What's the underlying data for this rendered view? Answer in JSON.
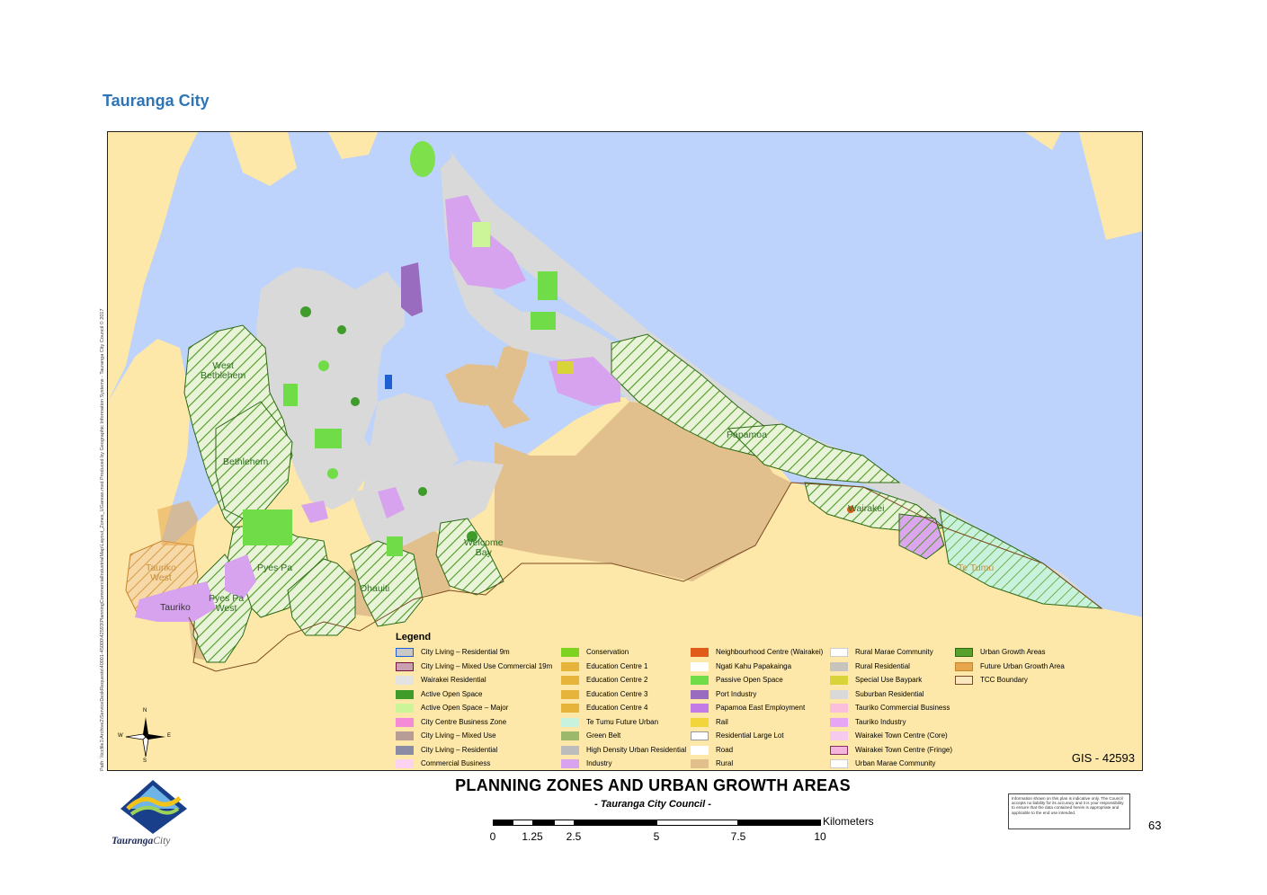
{
  "heading": "Tauranga City",
  "map": {
    "side_text": "Path: \\\\tccfile1\\Archive2\\ServiceDeskRequests\\40001-45000\\42593\\PlanningCommercialIndustrialMap\\Layout_Zones_UGareas.mxd     Produced by Geographic Information Systems - Tauranga City Council © 2017",
    "places": {
      "west_bethlehem": "West\nBethlehem",
      "bethlehem": "Bethlehem",
      "papamoa": "Papamoa",
      "wairakei": "Wairakei",
      "te_tumu": "Te Tumu",
      "welcome_bay": "Welcome\nBay",
      "pyes_pa": "Pyes Pa",
      "ohauiti": "Ohauiti",
      "pyes_pa_west": "Pyes Pa\nWest",
      "tauriko": "Tauriko",
      "tauriko_west": "Tauriko\nWest"
    },
    "colors": {
      "sea": "#bdd3fb",
      "rural": "#fde8a9",
      "suburban": "#d9d9d9",
      "urban_growth": "#5aa02c",
      "future_growth": "#e6a64d",
      "industry": "#d7a3ee",
      "rural_zone": "#e2c08d",
      "open_space": "#7ee04a",
      "te_tumu": "#c6f2de"
    },
    "gis_ref": "GIS - 42593"
  },
  "legend": {
    "title": "Legend",
    "items": [
      {
        "label": "City Living – Residential 9m",
        "fill": "#c8c8c8",
        "border": "#1f5fd1"
      },
      {
        "label": "City Living – Mixed Use Commercial 19m",
        "fill": "#c8a0b0",
        "border": "#7a1040"
      },
      {
        "label": "Wairakei Residential",
        "fill": "#e3e3e3",
        "border": "#e3e3e3"
      },
      {
        "label": "Active Open Space",
        "fill": "#3f9b2a",
        "border": "#3f9b2a"
      },
      {
        "label": "Active Open Space – Major",
        "fill": "#ccf59a",
        "border": "#ccf59a"
      },
      {
        "label": "City Centre Business Zone",
        "fill": "#f58ad7",
        "border": "#f58ad7"
      },
      {
        "label": "City Living – Mixed Use",
        "fill": "#b89c96",
        "border": "#b89c96"
      },
      {
        "label": "City Living – Residential",
        "fill": "#8a8ca6",
        "border": "#8a8ca6"
      },
      {
        "label": "Commercial Business",
        "fill": "#fbd3f0",
        "border": "#fbd3f0"
      },
      {
        "label": "Conservation",
        "fill": "#7ed321",
        "border": "#7ed321"
      },
      {
        "label": "Education Centre 1",
        "fill": "#e6b43b",
        "border": "#e6b43b"
      },
      {
        "label": "Education Centre 2",
        "fill": "#e6b43b",
        "border": "#e6b43b"
      },
      {
        "label": "Education Centre 3",
        "fill": "#e6b43b",
        "border": "#e6b43b"
      },
      {
        "label": "Education Centre 4",
        "fill": "#e6b43b",
        "border": "#e6b43b"
      },
      {
        "label": "Te Tumu Future Urban",
        "fill": "#c6f2de",
        "border": "#c6f2de"
      },
      {
        "label": "Green Belt",
        "fill": "#9cb86a",
        "border": "#9cb86a"
      },
      {
        "label": "High Density Urban Residential",
        "fill": "#bcbcbc",
        "border": "#bcbcbc"
      },
      {
        "label": "Industry",
        "fill": "#d7a3ee",
        "border": "#d7a3ee"
      },
      {
        "label": "Neighbourhood Centre (Wairakei)",
        "fill": "#e05a1a",
        "border": "#e05a1a"
      },
      {
        "label": "Ngati Kahu Papakainga",
        "fill": "#ffffff",
        "border": "#ffffff"
      },
      {
        "label": "Passive Open Space",
        "fill": "#6fdc48",
        "border": "#6fdc48"
      },
      {
        "label": "Port Industry",
        "fill": "#9a6cc0",
        "border": "#9a6cc0"
      },
      {
        "label": "Papamoa East Employment",
        "fill": "#c37ae6",
        "border": "#c37ae6"
      },
      {
        "label": "Rail",
        "fill": "#f2d53a",
        "border": "#f2d53a"
      },
      {
        "label": "Residential Large Lot",
        "fill": "#ffffff",
        "border": "#999999"
      },
      {
        "label": "Road",
        "fill": "#ffffff",
        "border": "#ffffff"
      },
      {
        "label": "Rural",
        "fill": "#e2c08d",
        "border": "#e2c08d"
      },
      {
        "label": "Rural Marae Community",
        "fill": "#ffffff",
        "border": "#cccccc"
      },
      {
        "label": "Rural Residential",
        "fill": "#c7c4bd",
        "border": "#c7c4bd"
      },
      {
        "label": "Special Use Baypark",
        "fill": "#d9d33a",
        "border": "#d9d33a"
      },
      {
        "label": "Suburban Residential",
        "fill": "#d9d9d9",
        "border": "#d9d9d9"
      },
      {
        "label": "Tauriko Commercial Business",
        "fill": "#fbbfdc",
        "border": "#fbbfdc"
      },
      {
        "label": "Tauriko Industry",
        "fill": "#e6a6f5",
        "border": "#e6a6f5"
      },
      {
        "label": "Wairakei Town Centre (Core)",
        "fill": "#f6c9ef",
        "border": "#f6c9ef"
      },
      {
        "label": "Wairakei Town Centre (Fringe)",
        "fill": "#f3b5dc",
        "border": "#8a3060"
      },
      {
        "label": "Urban Marae Community",
        "fill": "#ffffff",
        "border": "#cccccc"
      },
      {
        "label": "Urban Growth Areas",
        "fill": "#5aa02c",
        "border": "#2c6a14"
      },
      {
        "label": "Future Urban Growth Area",
        "fill": "#e6a64d",
        "border": "#c8842c"
      },
      {
        "label": "TCC Boundary",
        "fill": "#fbe7c0",
        "border": "#7a4a1e"
      }
    ]
  },
  "compass": {
    "n": "N",
    "s": "S",
    "e": "E",
    "w": "W"
  },
  "title": "PLANNING ZONES AND URBAN GROWTH AREAS",
  "subtitle": "- Tauranga City Council -",
  "scale": {
    "unit": "Kilometers",
    "ticks": [
      "0",
      "1.25",
      "2.5",
      "5",
      "7.5",
      "10"
    ]
  },
  "disclaimer": "Information shown on this plan is indicative only. The Council accepts no liability for its accuracy and it is your responsibility to ensure that the data contained herein is appropriate and applicable to the end use intended.",
  "page_number": "63",
  "logo": {
    "word": "Tauranga",
    "word2": "City"
  }
}
